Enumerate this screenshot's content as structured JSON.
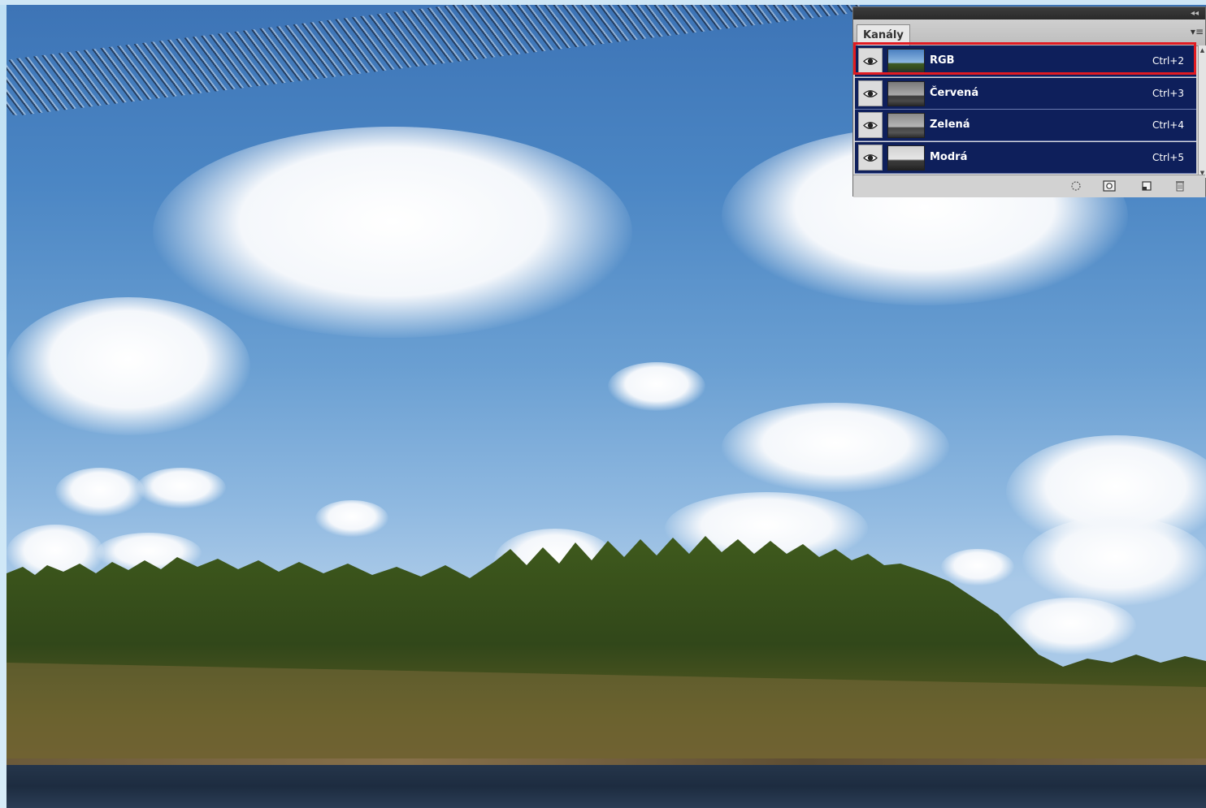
{
  "panel": {
    "tab_label": "Kanály",
    "collapse_glyph": "◂◂",
    "menu_glyph": "▾≡"
  },
  "channels": [
    {
      "name": "RGB",
      "shortcut": "Ctrl+2",
      "selected": true,
      "thumb": "color"
    },
    {
      "name": "Červená",
      "shortcut": "Ctrl+3",
      "selected": false,
      "thumb": "gray-light"
    },
    {
      "name": "Zelená",
      "shortcut": "Ctrl+4",
      "selected": false,
      "thumb": "gray-mid"
    },
    {
      "name": "Modrá",
      "shortcut": "Ctrl+5",
      "selected": false,
      "thumb": "gray-bright"
    }
  ],
  "footer_buttons": [
    {
      "icon": "load-channel-as-selection-icon"
    },
    {
      "icon": "save-selection-as-channel-icon"
    },
    {
      "icon": "new-channel-icon"
    },
    {
      "icon": "delete-channel-icon"
    }
  ],
  "colors": {
    "row_bg": "#0e1f5b",
    "selection_outline": "#e11b22",
    "sky_top": "#3d74b6",
    "sky_bottom": "#a9c9e8"
  }
}
